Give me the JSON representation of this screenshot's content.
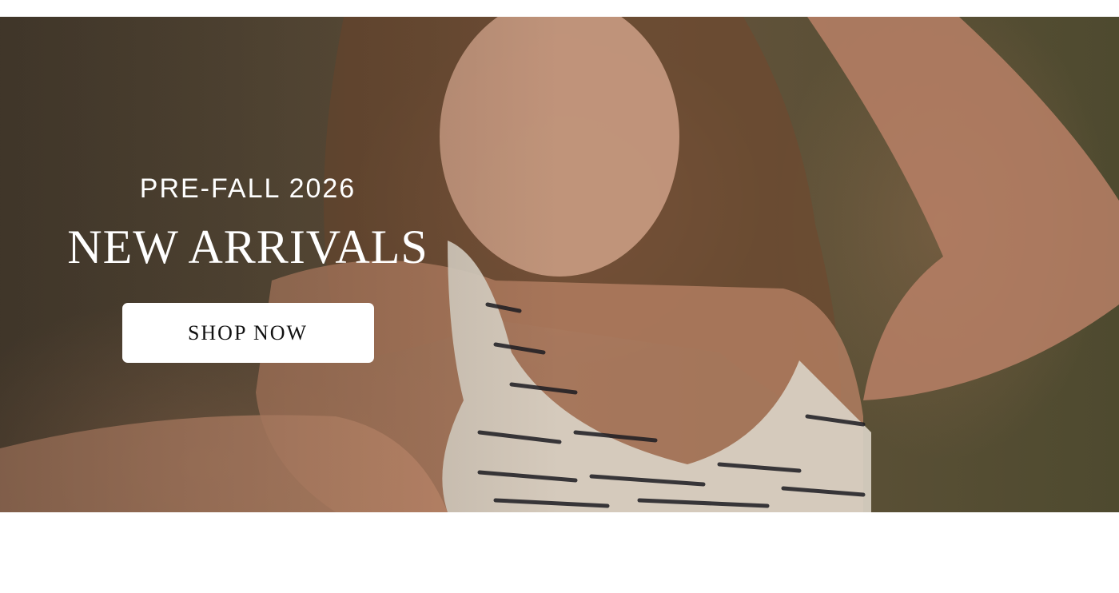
{
  "hero": {
    "eyebrow": "PRE-FALL 2026",
    "headline": "NEW ARRIVALS",
    "cta_label": "SHOP NOW",
    "image_alt": "model wearing tweed top"
  },
  "colors": {
    "page_background": "#ffffff",
    "hero_text": "#ffffff",
    "button_background": "#ffffff",
    "button_text": "#111111"
  }
}
